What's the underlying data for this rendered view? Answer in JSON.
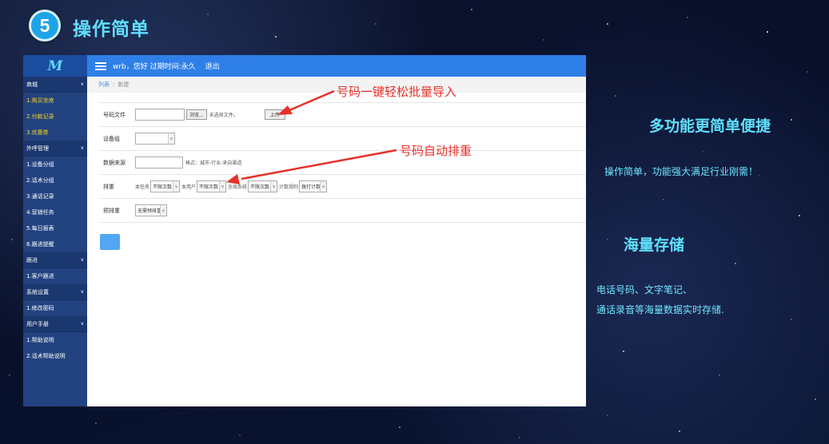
{
  "slide": {
    "number": "5",
    "heading": "操作简单"
  },
  "app": {
    "logo_text": "M",
    "topbar": {
      "user_text": "wrb，您好  过期时间:永久",
      "logout": "退出"
    },
    "sidebar": [
      {
        "title": "商城",
        "items": [
          "1.购买坐席",
          "2.付款记录",
          "3.优惠券"
        ]
      },
      {
        "title": "外呼管理",
        "items": [
          "1.设备分组",
          "2.话术分组",
          "3.通话记录",
          "4.营销任务",
          "5.每日报表",
          "6.跟进提醒"
        ]
      },
      {
        "title": "跟进",
        "items": [
          "1.客户跟进"
        ]
      },
      {
        "title": "系统设置",
        "items": [
          "1.修改密码"
        ]
      },
      {
        "title": "用户手册",
        "items": [
          "1.帮助说明",
          "2.话术帮助说明"
        ]
      }
    ],
    "breadcrumb": {
      "link": "列表",
      "current": "新建"
    },
    "form": {
      "file_label": "号码文件",
      "browse": "浏览...",
      "no_file": "未选择文件。",
      "upload": "上传",
      "group_label": "设备组",
      "source_label": "数据来源",
      "source_hint": "格式：城市-行业-来自渠道",
      "dedup_label": "排重",
      "this_task": "本任务",
      "this_task_val": "不限次数",
      "this_user": "本用户",
      "this_user_val": "不限次数",
      "global": "全局系统",
      "global_val": "不限次数",
      "count_rule": "计数规则",
      "count_rule_val": "拨打计数",
      "pre_dedup_label": "预排重",
      "pre_dedup_val": "无需预排重"
    }
  },
  "annotations": {
    "import": "号码一键轻松批量导入",
    "sort": "号码自动排重"
  },
  "right_panel": {
    "feature1_title": "多功能更简单便捷",
    "feature1_desc": "操作简单，功能强大满足行业刚需！",
    "feature2_title": "海量存储",
    "feature2_desc_line1": "电话号码、文字笔记、",
    "feature2_desc_line2": "通话录音等海量数据实时存储."
  },
  "colors": {
    "heading": "#5fe0ff",
    "annotation": "#e8312a",
    "topbar": "#2f7fe8",
    "sidebar": "#22437f",
    "highlight_item": "#f3d22b"
  }
}
